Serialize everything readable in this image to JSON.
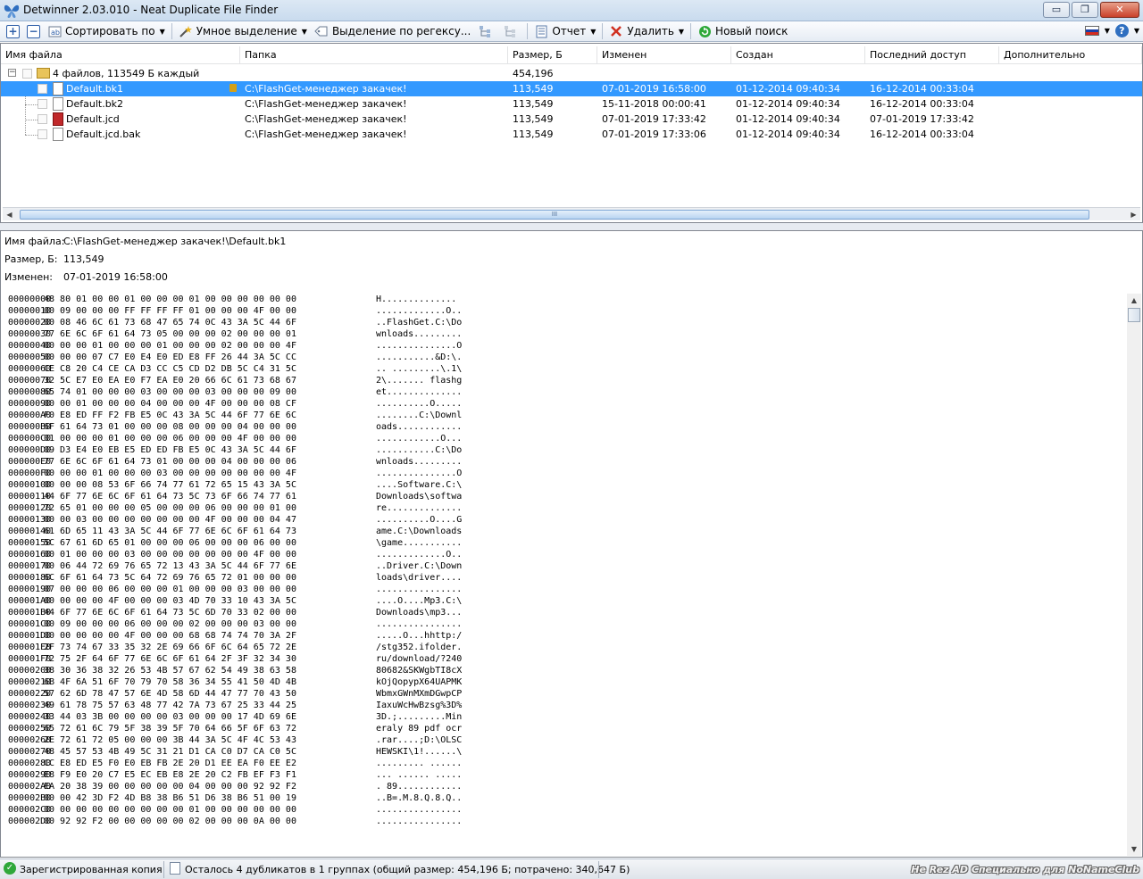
{
  "window": {
    "title": "Detwinner 2.03.010 - Neat Duplicate File Finder",
    "min_glyph": "▭",
    "max_glyph": "❐",
    "close_glyph": "✕"
  },
  "toolbar": {
    "expand_glyph": "+",
    "collapse_glyph": "−",
    "sort_label": "Сортировать по",
    "smart_select_label": "Умное выделение",
    "regex_select_label": "Выделение по регексу...",
    "report_label": "Отчет",
    "delete_label": "Удалить",
    "new_search_label": "Новый поиск",
    "help_glyph": "?",
    "dropdown_glyph": "▼"
  },
  "list": {
    "columns": [
      "Имя файла",
      "Папка",
      "Размер, Б",
      "Изменен",
      "Создан",
      "Последний доступ",
      "Дополнительно"
    ],
    "group": {
      "label": "4 файлов, 113549 Б каждый",
      "size": "454,196"
    },
    "rows": [
      {
        "name": "Default.bk1",
        "folder": "C:\\FlashGet-менеджер закачек!",
        "size": "113,549",
        "modified": "07-01-2019 16:58:00",
        "created": "01-12-2014 09:40:34",
        "accessed": "16-12-2014 00:33:04"
      },
      {
        "name": "Default.bk2",
        "folder": "C:\\FlashGet-менеджер закачек!",
        "size": "113,549",
        "modified": "15-11-2018 00:00:41",
        "created": "01-12-2014 09:40:34",
        "accessed": "16-12-2014 00:33:04"
      },
      {
        "name": "Default.jcd",
        "folder": "C:\\FlashGet-менеджер закачек!",
        "size": "113,549",
        "modified": "07-01-2019 17:33:42",
        "created": "01-12-2014 09:40:34",
        "accessed": "07-01-2019 17:33:42"
      },
      {
        "name": "Default.jcd.bak",
        "folder": "C:\\FlashGet-менеджер закачек!",
        "size": "113,549",
        "modified": "07-01-2019 17:33:06",
        "created": "01-12-2014 09:40:34",
        "accessed": "16-12-2014 00:33:04"
      }
    ],
    "scroll_left": "◀",
    "scroll_right": "▶",
    "scroll_grip": "III"
  },
  "details": {
    "filename_label": "Имя файла:",
    "filename_value": "C:\\FlashGet-менеджер закачек!\\Default.bk1",
    "size_label": "Размер, Б:",
    "size_value": "113,549",
    "modified_label": "Изменен:",
    "modified_value": "07-01-2019 16:58:00",
    "scroll_up": "▲",
    "scroll_down": "▼",
    "hex": [
      [
        "00000000",
        "48 80 01 00 00 01 00 00 00 01 00 00 00 00 00 00",
        "H.............."
      ],
      [
        "00000010",
        "00 09 00 00 00 FF FF FF FF 01 00 00 00 4F 00 00",
        ".............O.."
      ],
      [
        "00000020",
        "00 08 46 6C 61 73 68 47 65 74 0C 43 3A 5C 44 6F",
        "..FlashGet.C:\\Do"
      ],
      [
        "00000030",
        "77 6E 6C 6F 61 64 73 05 00 00 00 02 00 00 00 01",
        "wnloads........."
      ],
      [
        "00000040",
        "00 00 00 01 00 00 00 01 00 00 00 02 00 00 00 4F",
        "...............O"
      ],
      [
        "00000050",
        "00 00 00 07 C7 E0 E4 E0 ED E8 FF 26 44 3A 5C CC",
        "...........&D:\\."
      ],
      [
        "00000060",
        "CE C8 20 C4 CE CA D3 CC C5 CD D2 DB 5C C4 31 5C",
        ".. .........\\.1\\"
      ],
      [
        "00000070",
        "32 5C E7 E0 EA E0 F7 EA E0 20 66 6C 61 73 68 67",
        "2\\....... flashg"
      ],
      [
        "00000080",
        "65 74 01 00 00 00 03 00 00 00 03 00 00 00 09 00",
        "et.............."
      ],
      [
        "00000090",
        "00 00 01 00 00 00 04 00 00 00 4F 00 00 00 08 CF",
        "..........O....."
      ],
      [
        "000000A0",
        "F0 E8 ED FF F2 FB E5 0C 43 3A 5C 44 6F 77 6E 6C",
        "........C:\\Downl"
      ],
      [
        "000000B0",
        "6F 61 64 73 01 00 00 00 08 00 00 00 04 00 00 00",
        "oads............"
      ],
      [
        "000000C0",
        "01 00 00 00 01 00 00 00 06 00 00 00 4F 00 00 00",
        "............O..."
      ],
      [
        "000000D0",
        "09 D3 E4 E0 EB E5 ED ED FB E5 0C 43 3A 5C 44 6F",
        "...........C:\\Do"
      ],
      [
        "000000E0",
        "77 6E 6C 6F 61 64 73 01 00 00 00 04 00 00 00 06",
        "wnloads........."
      ],
      [
        "000000F0",
        "00 00 00 01 00 00 00 03 00 00 00 00 00 00 00 4F",
        "...............O"
      ],
      [
        "00000100",
        "00 00 00 08 53 6F 66 74 77 61 72 65 15 43 3A 5C",
        "....Software.C:\\"
      ],
      [
        "00000110",
        "44 6F 77 6E 6C 6F 61 64 73 5C 73 6F 66 74 77 61",
        "Downloads\\softwa"
      ],
      [
        "00000120",
        "72 65 01 00 00 00 05 00 00 00 06 00 00 00 01 00",
        "re.............."
      ],
      [
        "00000130",
        "00 00 03 00 00 00 00 00 00 00 4F 00 00 00 04 47",
        "..........O....G"
      ],
      [
        "00000140",
        "61 6D 65 11 43 3A 5C 44 6F 77 6E 6C 6F 61 64 73",
        "ame.C:\\Downloads"
      ],
      [
        "00000150",
        "5C 67 61 6D 65 01 00 00 00 06 00 00 00 06 00 00",
        "\\game..........."
      ],
      [
        "00000160",
        "00 01 00 00 00 03 00 00 00 00 00 00 00 4F 00 00",
        ".............O.."
      ],
      [
        "00000170",
        "00 06 44 72 69 76 65 72 13 43 3A 5C 44 6F 77 6E",
        "..Driver.C:\\Down"
      ],
      [
        "00000180",
        "6C 6F 61 64 73 5C 64 72 69 76 65 72 01 00 00 00",
        "loads\\driver...."
      ],
      [
        "00000190",
        "07 00 00 00 06 00 00 00 01 00 00 00 03 00 00 00",
        "................"
      ],
      [
        "000001A0",
        "00 00 00 00 4F 00 00 00 03 4D 70 33 10 43 3A 5C",
        "....O....Mp3.C:\\"
      ],
      [
        "000001B0",
        "44 6F 77 6E 6C 6F 61 64 73 5C 6D 70 33 02 00 00",
        "Downloads\\mp3..."
      ],
      [
        "000001C0",
        "00 09 00 00 00 06 00 00 00 02 00 00 00 03 00 00",
        "................"
      ],
      [
        "000001D0",
        "00 00 00 00 00 4F 00 00 00 68 68 74 74 70 3A 2F",
        ".....O...hhttp:/"
      ],
      [
        "000001E0",
        "2F 73 74 67 33 35 32 2E 69 66 6F 6C 64 65 72 2E",
        "/stg352.ifolder."
      ],
      [
        "000001F0",
        "72 75 2F 64 6F 77 6E 6C 6F 61 64 2F 3F 32 34 30",
        "ru/download/?240"
      ],
      [
        "00000200",
        "38 30 36 38 32 26 53 4B 57 67 62 54 49 38 63 58",
        "80682&SKWgbTI8cX"
      ],
      [
        "00000210",
        "6B 4F 6A 51 6F 70 79 70 58 36 34 55 41 50 4D 4B",
        "kOjQopypX64UAPMK"
      ],
      [
        "00000220",
        "57 62 6D 78 47 57 6E 4D 58 6D 44 47 77 70 43 50",
        "WbmxGWnMXmDGwpCP"
      ],
      [
        "00000230",
        "49 61 78 75 57 63 48 77 42 7A 73 67 25 33 44 25",
        "IaxuWcHwBzsg%3D%"
      ],
      [
        "00000240",
        "33 44 03 3B 00 00 00 00 03 00 00 00 17 4D 69 6E",
        "3D.;.........Min"
      ],
      [
        "00000250",
        "65 72 61 6C 79 5F 38 39 5F 70 64 66 5F 6F 63 72",
        "eraly 89 pdf ocr"
      ],
      [
        "00000260",
        "2E 72 61 72 05 00 00 00 3B 44 3A 5C 4F 4C 53 43",
        ".rar....;D:\\OLSC"
      ],
      [
        "00000270",
        "48 45 57 53 4B 49 5C 31 21 D1 CA C0 D7 CA C0 5C",
        "HEWSKI\\1!......\\"
      ],
      [
        "00000280",
        "CC E8 ED E5 F0 E0 EB FB 2E 20 D1 EE EA F0 EE E2",
        "......... ......"
      ],
      [
        "00000290",
        "E8 F9 E0 20 C7 E5 EC EB E8 2E 20 C2 FB EF F3 F1",
        "... ...... ....."
      ],
      [
        "000002A0",
        "EA 20 38 39 00 00 00 00 00 04 00 00 00 92 92 F2",
        ". 89............"
      ],
      [
        "000002B0",
        "00 00 42 3D F2 4D B8 38 B6 51 D6 38 B6 51 00 19",
        "..B=.M.8.Q.8.Q.."
      ],
      [
        "000002C0",
        "00 00 00 00 00 00 00 00 00 01 00 00 00 00 00 00",
        "................"
      ],
      [
        "000002D0",
        "00 92 92 F2 00 00 00 00 00 02 00 00 00 0A 00 00",
        "................"
      ]
    ]
  },
  "status": {
    "registered": "Зарегистрированная копия",
    "summary": "Осталось 4 дубликатов в 1 группах (общий размер: 454,196 Б; потрачено: 340,647 Б)",
    "watermark": "Не Rez AD Специально для NoNameClub"
  },
  "colors": {
    "selection": "#3399ff",
    "accent": "#2f5fa8",
    "delete": "#d03020",
    "new_search": "#2fa83a"
  }
}
